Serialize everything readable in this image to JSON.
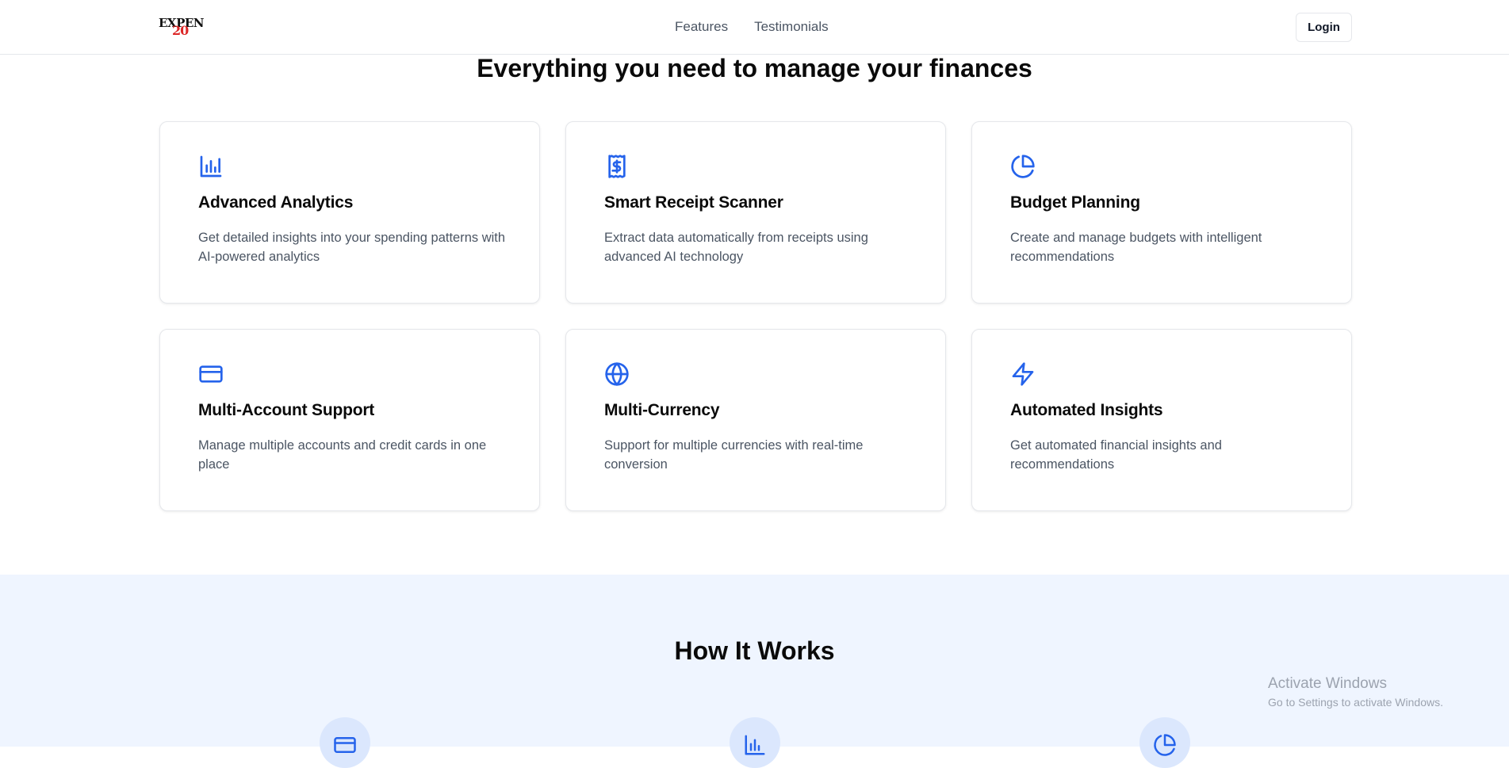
{
  "navbar": {
    "logo_top": "EXPEN",
    "logo_bottom": "20",
    "links": [
      "Features",
      "Testimonials"
    ],
    "login_label": "Login"
  },
  "features": {
    "title": "Everything you need to manage your finances",
    "cards": [
      {
        "icon": "bar-chart-icon",
        "title": "Advanced Analytics",
        "desc": "Get detailed insights into your spending patterns with AI-powered analytics"
      },
      {
        "icon": "receipt-icon",
        "title": "Smart Receipt Scanner",
        "desc": "Extract data automatically from receipts using advanced AI technology"
      },
      {
        "icon": "pie-chart-icon",
        "title": "Budget Planning",
        "desc": "Create and manage budgets with intelligent recommendations"
      },
      {
        "icon": "credit-card-icon",
        "title": "Multi-Account Support",
        "desc": "Manage multiple accounts and credit cards in one place"
      },
      {
        "icon": "globe-icon",
        "title": "Multi-Currency",
        "desc": "Support for multiple currencies with real-time conversion"
      },
      {
        "icon": "zap-icon",
        "title": "Automated Insights",
        "desc": "Get automated financial insights and recommendations"
      }
    ]
  },
  "how": {
    "title": "How It Works",
    "steps": [
      {
        "icon": "credit-card-icon"
      },
      {
        "icon": "bar-chart-icon"
      },
      {
        "icon": "pie-chart-icon"
      }
    ]
  },
  "watermark": {
    "title": "Activate Windows",
    "subtitle": "Go to Settings to activate Windows."
  },
  "colors": {
    "accent": "#2563eb",
    "section_bg": "#eff5ff",
    "icon_circle": "#dbe7fd",
    "muted_text": "#4b5563",
    "logo_red": "#dc2626"
  }
}
